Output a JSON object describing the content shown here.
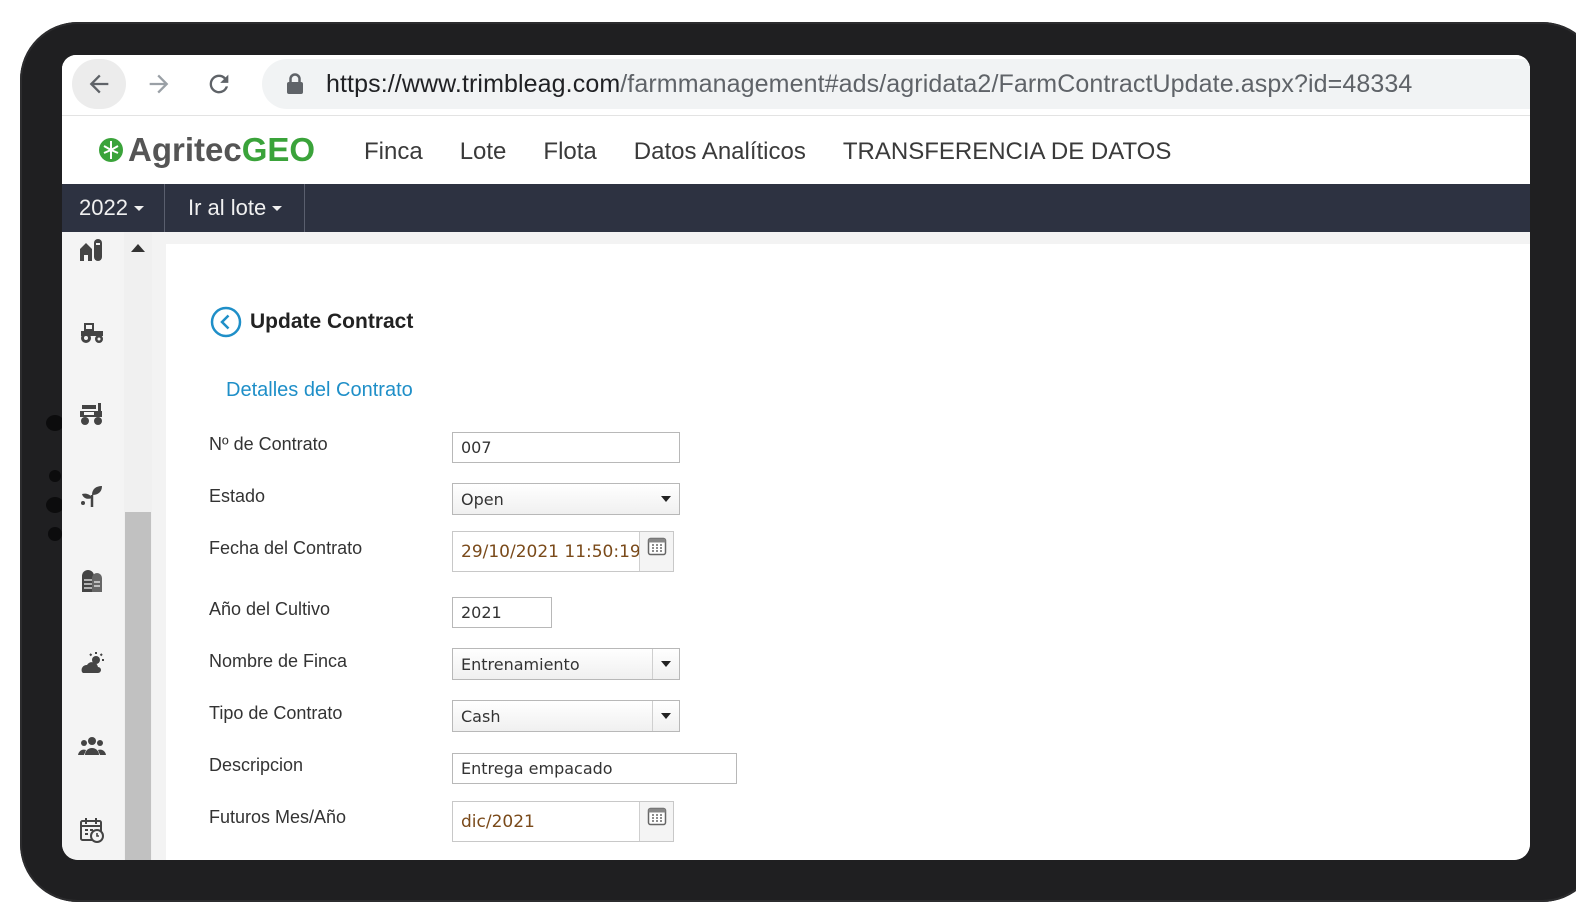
{
  "browser": {
    "url_domain": "https://www.trimbleag.com",
    "url_path": "/farmmanagement#ads/agridata2/FarmContractUpdate.aspx?id=48334"
  },
  "app": {
    "logo_main": "Agritec",
    "logo_accent": "GEO",
    "nav": [
      "Finca",
      "Lote",
      "Flota",
      "Datos Analíticos",
      "TRANSFERENCIA DE DATOS"
    ]
  },
  "toolbar": {
    "year": "2022",
    "go_to_lot": "Ir al lote"
  },
  "sidebar_icons": [
    "farm-icon",
    "tractor-icon",
    "machinery-icon",
    "crop-icon",
    "storage-icon",
    "weather-icon",
    "people-icon",
    "calendar-icon"
  ],
  "page": {
    "title": "Update Contract",
    "section": "Detalles del Contrato"
  },
  "form": {
    "contract_number": {
      "label": "Nº de Contrato",
      "value": "007"
    },
    "status": {
      "label": "Estado",
      "value": "Open"
    },
    "contract_date": {
      "label": "Fecha del Contrato",
      "value": "29/10/2021 11:50:19"
    },
    "crop_year": {
      "label": "Año del Cultivo",
      "value": "2021"
    },
    "farm_name": {
      "label": "Nombre de Finca",
      "value": "Entrenamiento"
    },
    "contract_type": {
      "label": "Tipo de Contrato",
      "value": "Cash"
    },
    "description": {
      "label": "Descripcion",
      "value": "Entrega empacado"
    },
    "futures": {
      "label": "Futuros Mes/Año",
      "value": "dic/2021"
    }
  },
  "colors": {
    "toolbar_bg": "#2d3241",
    "accent_link": "#1f8fc8",
    "logo_green": "#3aa33a"
  }
}
